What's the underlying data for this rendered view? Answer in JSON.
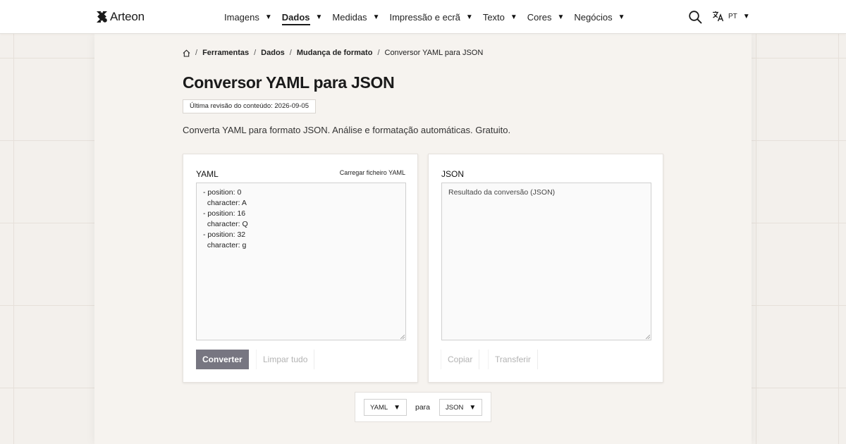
{
  "header": {
    "brand": "Arteon",
    "nav": [
      {
        "label": "Imagens",
        "active": false
      },
      {
        "label": "Dados",
        "active": true
      },
      {
        "label": "Medidas",
        "active": false
      },
      {
        "label": "Impressão e ecrã",
        "active": false
      },
      {
        "label": "Texto",
        "active": false
      },
      {
        "label": "Cores",
        "active": false
      },
      {
        "label": "Negócios",
        "active": false
      }
    ],
    "language_code": "PT",
    "icons": {
      "search": "search-icon",
      "language": "translate-icon"
    }
  },
  "breadcrumb": {
    "home_icon": "home-icon",
    "items": [
      "Ferramentas",
      "Dados",
      "Mudança de formato"
    ],
    "current": "Conversor YAML para JSON"
  },
  "page": {
    "title": "Conversor YAML para JSON",
    "revision": "Última revisão do conteúdo: 2026-09-05",
    "description": "Converta YAML para formato JSON. Análise e formatação automáticas. Gratuito."
  },
  "input_panel": {
    "label": "YAML",
    "upload_link": "Carregar ficheiro YAML",
    "value": "- position: 0\n  character: A\n- position: 16\n  character: Q\n- position: 32\n  character: g",
    "convert_button": "Converter",
    "clear_button": "Limpar tudo"
  },
  "output_panel": {
    "label": "JSON",
    "placeholder": "Resultado da conversão (JSON)",
    "copy_button": "Copiar",
    "download_button": "Transferir"
  },
  "format_bar": {
    "from": "YAML",
    "separator": "para",
    "to": "JSON"
  },
  "colors": {
    "primary_button": "#777681",
    "background": "#f3f0ec"
  }
}
